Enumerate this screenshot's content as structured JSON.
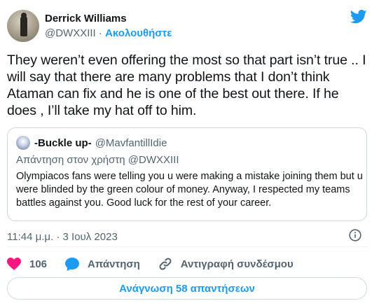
{
  "author": {
    "display_name": "Derrick Williams",
    "handle": "@DWXXIII",
    "separator": "·",
    "follow_label": "Ακολουθήστε"
  },
  "tweet": {
    "text": "They weren’t even offering the most so that part isn’t true .. I will say that there are many problems that I don’t think Ataman can fix and he is one of the best out there.  If he does , I’ll take my hat off to him."
  },
  "quoted": {
    "display_name": "-Buckle up-",
    "handle": "@MavfantillIdie",
    "reply_context": "Απάντηση στον χρήστη @DWXXIII",
    "text": "Olympiacos fans were telling you u were making a mistake joining them but u were blinded by the green colour of money. Anyway, I respected my teams battles against you. Good luck for the rest of your career."
  },
  "meta": {
    "timestamp": "11:44 μ.μ. · 3 Ιουλ 2023"
  },
  "actions": {
    "like_count": "106",
    "reply_label": "Απάντηση",
    "copy_link_label": "Αντιγραφή συνδέσμου"
  },
  "footer": {
    "read_replies_label": "Ανάγνωση 58 απαντήσεων"
  },
  "colors": {
    "accent": "#1d9bf0",
    "like": "#f91880",
    "secondary_text": "#536471",
    "border": "#cfd9de"
  },
  "icons": {
    "brand": "twitter-bird-icon",
    "info": "info-icon",
    "like": "heart-icon",
    "reply": "speech-bubble-icon",
    "copy_link": "link-icon"
  }
}
